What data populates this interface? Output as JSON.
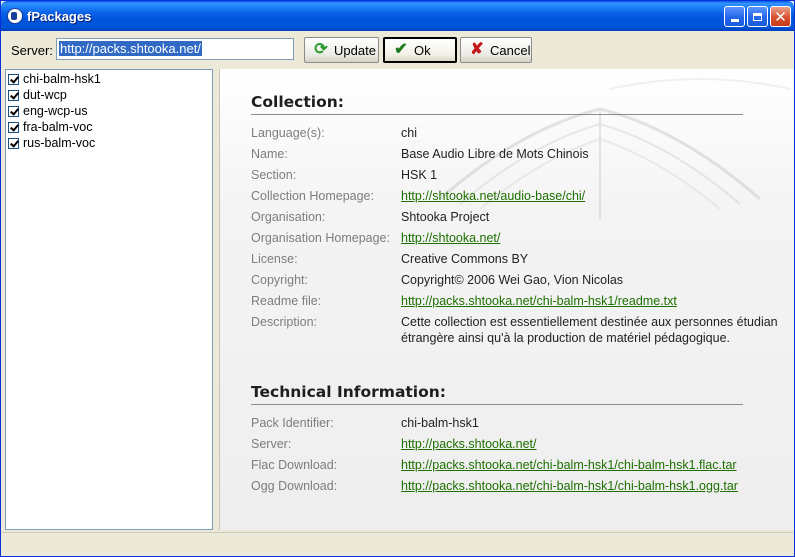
{
  "window": {
    "title": "fPackages"
  },
  "toolbar": {
    "server_label": "Server:",
    "server_value": "http://packs.shtooka.net/",
    "update_label": "Update",
    "ok_label": "Ok",
    "cancel_label": "Cancel",
    "update_icon": "refresh-icon",
    "ok_icon": "checkmark-icon",
    "cancel_icon": "x-icon"
  },
  "packs": [
    {
      "name": "chi-balm-hsk1",
      "checked": true
    },
    {
      "name": "dut-wcp",
      "checked": true
    },
    {
      "name": "eng-wcp-us",
      "checked": true
    },
    {
      "name": "fra-balm-voc",
      "checked": true
    },
    {
      "name": "rus-balm-voc",
      "checked": true
    }
  ],
  "collection": {
    "title": "Collection:",
    "rows": [
      {
        "label": "Language(s):",
        "value": "chi"
      },
      {
        "label": "Name:",
        "value": "Base Audio Libre de Mots Chinois"
      },
      {
        "label": "Section:",
        "value": "HSK 1"
      },
      {
        "label": "Collection Homepage:",
        "value": "http://shtooka.net/audio-base/chi/"
      },
      {
        "label": "Organisation:",
        "value": "Shtooka Project"
      },
      {
        "label": "Organisation Homepage:",
        "value": "http://shtooka.net/"
      },
      {
        "label": "License:",
        "value": "Creative Commons BY"
      },
      {
        "label": "Copyright:",
        "value": "Copyright© 2006 Wei Gao, Vion Nicolas"
      },
      {
        "label": "Readme file:",
        "value": "http://packs.shtooka.net/chi-balm-hsk1/readme.txt"
      },
      {
        "label": "Description:",
        "value": "Cette collection est essentiellement destinée aux personnes étudian",
        "value2": "étrangère ainsi qu'à la production de matériel pédagogique."
      }
    ]
  },
  "technical": {
    "title": "Technical Information:",
    "rows": [
      {
        "label": "Pack Identifier:",
        "value": "chi-balm-hsk1"
      },
      {
        "label": "Server:",
        "value": "http://packs.shtooka.net/"
      },
      {
        "label": "Flac Download:",
        "value": "http://packs.shtooka.net/chi-balm-hsk1/chi-balm-hsk1.flac.tar"
      },
      {
        "label": "Ogg Download:",
        "value": "http://packs.shtooka.net/chi-balm-hsk1/chi-balm-hsk1.ogg.tar"
      }
    ]
  },
  "colors": {
    "titlebar": "#0054e3",
    "link": "#1d6f00",
    "label": "#7d7d7d",
    "selection": "#316ac5"
  }
}
